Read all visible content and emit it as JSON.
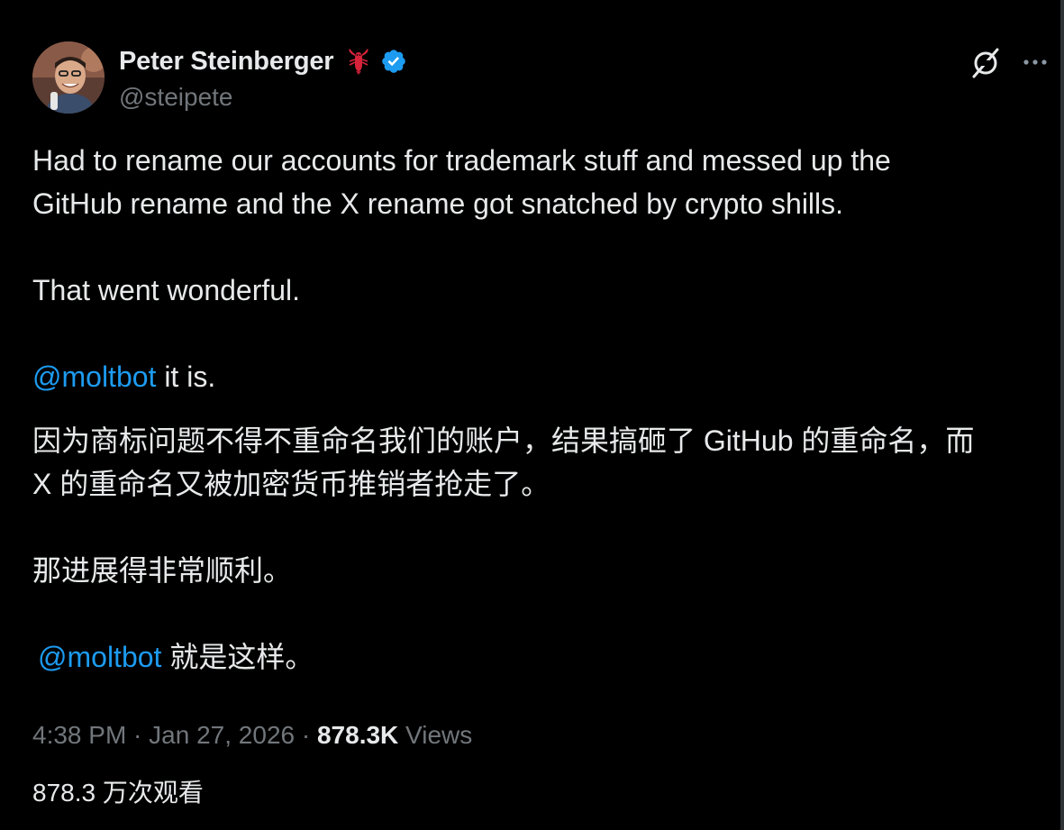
{
  "author": {
    "display_name": "Peter Steinberger",
    "handle": "@steipete",
    "emoji_icon": "lobster-icon",
    "verified_icon": "verified-badge-icon"
  },
  "actions": {
    "grok_icon": "grok-icon",
    "more_icon": "more-icon"
  },
  "tweet": {
    "en_line1": "Had to rename our accounts for trademark stuff and messed up the",
    "en_line2": "GitHub rename and the X rename got snatched by crypto shills.",
    "en_line3": "That went wonderful.",
    "en_mention": "@moltbot",
    "en_mention_suffix": " it is.",
    "cn_line1": "因为商标问题不得不重命名我们的账户，结果搞砸了 GitHub 的重命名，而",
    "cn_line2": "X 的重命名又被加密货币推销者抢走了。",
    "cn_line3": "那进展得非常顺利。",
    "cn_mention": "@moltbot",
    "cn_mention_suffix": " 就是这样。"
  },
  "meta": {
    "time": "4:38 PM",
    "separator": " · ",
    "date": "Jan 27, 2026",
    "views_count": "878.3K",
    "views_label": " Views",
    "views_cn": "878.3 万次观看"
  },
  "colors": {
    "background": "#000000",
    "text": "#e7e9ea",
    "secondary": "#71767b",
    "link": "#1d9bf0",
    "verified": "#1d9bf0"
  }
}
